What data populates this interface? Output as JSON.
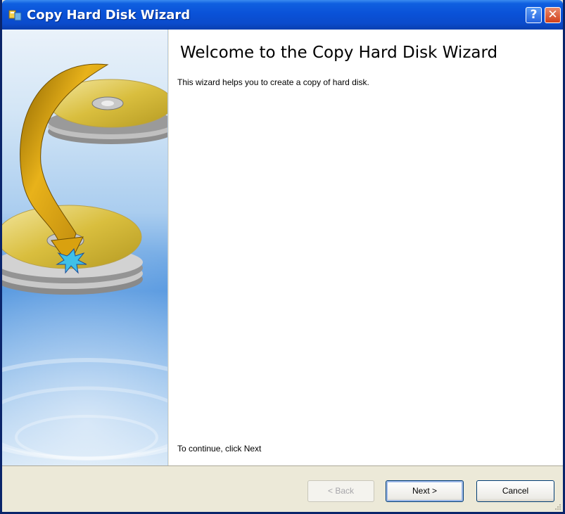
{
  "window": {
    "title": "Copy Hard Disk Wizard",
    "help_label": "?",
    "close_label": "✕"
  },
  "content": {
    "heading": "Welcome to the Copy Hard Disk Wizard",
    "description": "This wizard helps you to create a copy of hard disk.",
    "continue_hint": "To continue, click Next"
  },
  "buttons": {
    "back": "< Back",
    "next": "Next >",
    "cancel": "Cancel",
    "back_enabled": false
  },
  "icons": {
    "app": "disk-wizard-icon",
    "help": "help-icon",
    "close": "close-icon",
    "illustration": "disk-copy-illustration"
  },
  "colors": {
    "titlebar": "#0A52D8",
    "dialog_bg": "#ECE9D8",
    "close_button": "#D1401A"
  }
}
